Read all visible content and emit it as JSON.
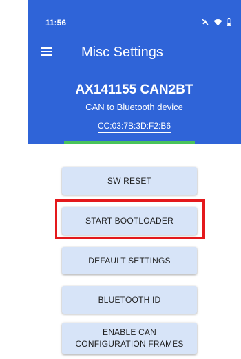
{
  "status_bar": {
    "time": "11:56",
    "icons": [
      "do-not-disturb-icon",
      "wifi-icon",
      "battery-icon"
    ]
  },
  "toolbar": {
    "menu_icon": "menu-icon",
    "title": "Misc Settings"
  },
  "device": {
    "name": "AX141155 CAN2BT",
    "description": "CAN to Bluetooth device",
    "address": "CC:03:7B:3D:F2:B6"
  },
  "buttons": [
    {
      "label": "SW RESET"
    },
    {
      "label": "START BOOTLOADER"
    },
    {
      "label": "DEFAULT SETTINGS"
    },
    {
      "label": "BLUETOOTH ID"
    },
    {
      "label": "ENABLE CAN\nCONFIGURATION FRAMES"
    }
  ],
  "colors": {
    "header_bg": "#2f64d8",
    "button_bg": "#d7e4f8",
    "highlight": "#e4191c",
    "status_strip": "#49c35a"
  }
}
